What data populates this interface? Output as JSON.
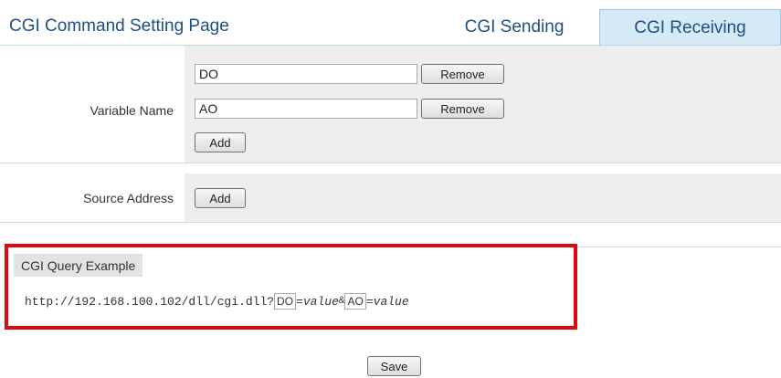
{
  "header": {
    "title": "CGI Command Setting Page",
    "tabs": [
      {
        "label": "CGI Sending",
        "active": false
      },
      {
        "label": "CGI Receiving",
        "active": true
      }
    ]
  },
  "variable_name": {
    "label": "Variable Name",
    "entries": [
      {
        "value": "DO",
        "remove_label": "Remove"
      },
      {
        "value": "AO",
        "remove_label": "Remove"
      }
    ],
    "add_label": "Add"
  },
  "source_address": {
    "label": "Source Address",
    "add_label": "Add"
  },
  "query_example": {
    "label": "CGI Query Example",
    "url": "http://192.168.100.102/dll/cgi.dll?",
    "var1": "DO",
    "eq1": "=",
    "val1": "value",
    "amp": "&",
    "var2": "AO",
    "eq2": "=",
    "val2": "value"
  },
  "save_label": "Save",
  "colors": {
    "title": "#1e4f84",
    "active_tab_bg": "#d6eaf5",
    "row_bg": "#eeeeee",
    "highlight_border": "#e30613"
  }
}
